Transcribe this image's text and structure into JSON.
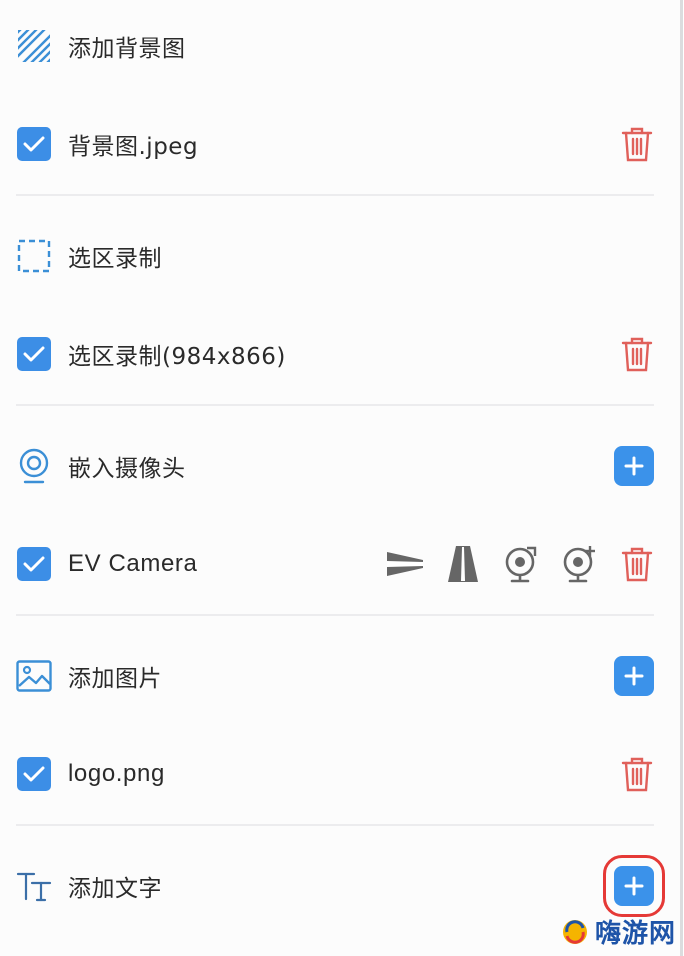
{
  "panel": {
    "rows": [
      {
        "label": "添加背景图",
        "icon": "hatched-square-icon",
        "action": null
      },
      {
        "label": "背景图.jpeg",
        "checked": true,
        "action": "delete"
      },
      {
        "label": "选区录制",
        "icon": "dashed-selection-icon",
        "action": null
      },
      {
        "label": "选区录制(984x866)",
        "checked": true,
        "action": "delete"
      },
      {
        "label": "嵌入摄像头",
        "icon": "webcam-icon",
        "action": "add"
      },
      {
        "label": "EV Camera",
        "checked": true,
        "action": "delete",
        "tools": [
          "flip-horizontal-icon",
          "flip-vertical-icon",
          "rotate-camera-icon",
          "camera-settings-icon"
        ]
      },
      {
        "label": "添加图片",
        "icon": "image-icon",
        "action": "add"
      },
      {
        "label": "logo.png",
        "checked": true,
        "action": "delete"
      },
      {
        "label": "添加文字",
        "icon": "text-tool-icon",
        "action": "add",
        "highlighted": true
      }
    ]
  },
  "colors": {
    "accent_blue": "#3b92ea",
    "delete_red": "#e0605a",
    "highlight_red": "#e53936"
  },
  "watermark": {
    "text": "嗨游网"
  }
}
